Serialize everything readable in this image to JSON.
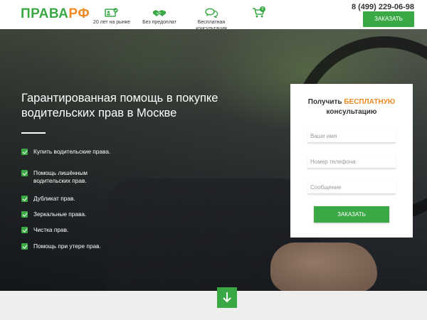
{
  "header": {
    "logo": {
      "part1": "ПРАВА",
      "part2": "РФ"
    },
    "features": [
      {
        "label": "20 лет на рынке",
        "icon": "id-card-check-icon"
      },
      {
        "label": "Без предоплат",
        "icon": "handshake-icon"
      },
      {
        "label": "Бесплатная консультация",
        "icon": "chat-bubbles-icon"
      }
    ],
    "cart": {
      "icon": "shopping-cart-icon",
      "count": "0"
    },
    "phone": "8 (499) 229-06-98",
    "order_button": "ЗАКАЗАТЬ"
  },
  "hero": {
    "title": "Гарантированная помощь в покупке водительских прав в Москве",
    "checklist": [
      "Купить водительские права.",
      "Помощь лишённым водительских прав.",
      "Дубликат прав.",
      "Зеркальные права.",
      "Чистка прав.",
      "Помощь при утере прав."
    ]
  },
  "form": {
    "title_part1": "Получить ",
    "title_highlight": "БЕСПЛАТНУЮ",
    "title_part2": "консультацию",
    "name_placeholder": "Ваше имя",
    "phone_placeholder": "Номер телефона",
    "message_placeholder": "Сообщение",
    "submit_label": "ЗАКАЗАТЬ"
  },
  "colors": {
    "accent": "#3aa945",
    "highlight": "#f08a24"
  },
  "scroll_down": {
    "icon": "arrow-down-icon"
  }
}
